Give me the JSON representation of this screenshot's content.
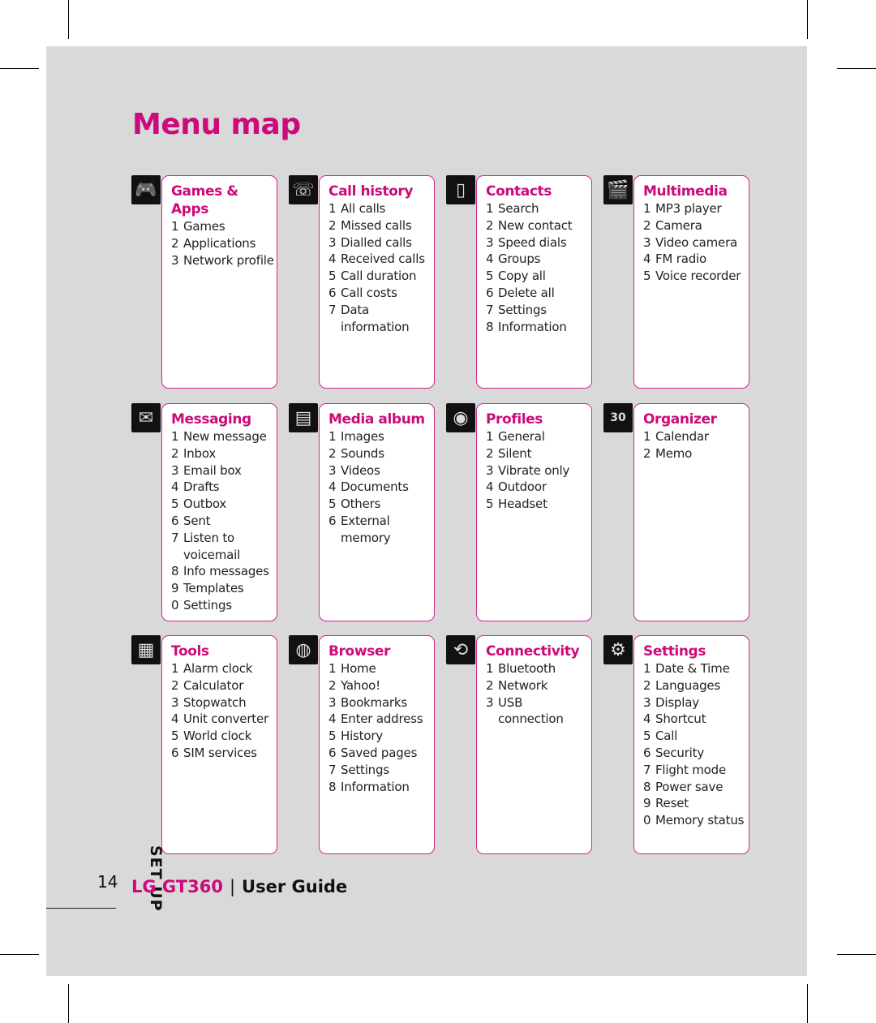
{
  "page_title": "Menu map",
  "side_label": "SET UP",
  "page_number": "14",
  "footer": {
    "brand": "LG GT360",
    "separator": "|",
    "guide": "User Guide"
  },
  "accent_color": "#cc0a7a",
  "menus": [
    {
      "icon": "gamepad-icon",
      "title": "Games & Apps",
      "items": [
        [
          "1",
          "Games"
        ],
        [
          "2",
          "Applications"
        ],
        [
          "3",
          "Network profile"
        ]
      ]
    },
    {
      "icon": "call-history-icon",
      "title": "Call history",
      "items": [
        [
          "1",
          "All calls"
        ],
        [
          "2",
          "Missed calls"
        ],
        [
          "3",
          "Dialled calls"
        ],
        [
          "4",
          "Received calls"
        ],
        [
          "5",
          "Call duration"
        ],
        [
          "6",
          "Call costs"
        ],
        [
          "7",
          "Data information"
        ]
      ]
    },
    {
      "icon": "contacts-icon",
      "title": "Contacts",
      "items": [
        [
          "1",
          "Search"
        ],
        [
          "2",
          "New contact"
        ],
        [
          "3",
          "Speed dials"
        ],
        [
          "4",
          "Groups"
        ],
        [
          "5",
          "Copy all"
        ],
        [
          "6",
          "Delete all"
        ],
        [
          "7",
          "Settings"
        ],
        [
          "8",
          "Information"
        ]
      ]
    },
    {
      "icon": "clapperboard-icon",
      "title": "Multimedia",
      "items": [
        [
          "1",
          "MP3 player"
        ],
        [
          "2",
          "Camera"
        ],
        [
          "3",
          "Video camera"
        ],
        [
          "4",
          "FM radio"
        ],
        [
          "5",
          "Voice recorder"
        ]
      ]
    },
    {
      "icon": "envelope-icon",
      "title": "Messaging",
      "items": [
        [
          "1",
          "New message"
        ],
        [
          "2",
          "Inbox"
        ],
        [
          "3",
          "Email box"
        ],
        [
          "4",
          "Drafts"
        ],
        [
          "5",
          "Outbox"
        ],
        [
          "6",
          "Sent"
        ],
        [
          "7",
          "Listen to voicemail"
        ],
        [
          "8",
          "Info messages"
        ],
        [
          "9",
          "Templates"
        ],
        [
          "0",
          "Settings"
        ]
      ]
    },
    {
      "icon": "folder-icon",
      "title": "Media album",
      "items": [
        [
          "1",
          "Images"
        ],
        [
          "2",
          "Sounds"
        ],
        [
          "3",
          "Videos"
        ],
        [
          "4",
          "Documents"
        ],
        [
          "5",
          "Others"
        ],
        [
          "6",
          "External memory"
        ]
      ]
    },
    {
      "icon": "speaker-icon",
      "title": "Profiles",
      "items": [
        [
          "1",
          "General"
        ],
        [
          "2",
          "Silent"
        ],
        [
          "3",
          "Vibrate only"
        ],
        [
          "4",
          "Outdoor"
        ],
        [
          "5",
          "Headset"
        ]
      ]
    },
    {
      "icon": "calendar-icon",
      "title": "Organizer",
      "items": [
        [
          "1",
          "Calendar"
        ],
        [
          "2",
          "Memo"
        ]
      ]
    },
    {
      "icon": "calculator-icon",
      "title": "Tools",
      "items": [
        [
          "1",
          "Alarm clock"
        ],
        [
          "2",
          "Calculator"
        ],
        [
          "3",
          "Stopwatch"
        ],
        [
          "4",
          "Unit converter"
        ],
        [
          "5",
          "World clock"
        ],
        [
          "6",
          "SIM services"
        ]
      ]
    },
    {
      "icon": "globe-icon",
      "title": "Browser",
      "items": [
        [
          "1",
          "Home"
        ],
        [
          "2",
          "Yahoo!"
        ],
        [
          "3",
          "Bookmarks"
        ],
        [
          "4",
          "Enter address"
        ],
        [
          "5",
          "History"
        ],
        [
          "6",
          "Saved pages"
        ],
        [
          "7",
          "Settings"
        ],
        [
          "8",
          "Information"
        ]
      ]
    },
    {
      "icon": "connectivity-icon",
      "title": "Connectivity",
      "items": [
        [
          "1",
          "Bluetooth"
        ],
        [
          "2",
          "Network"
        ],
        [
          "3",
          "USB connection"
        ]
      ]
    },
    {
      "icon": "gear-icon",
      "title": "Settings",
      "items": [
        [
          "1",
          "Date & Time"
        ],
        [
          "2",
          "Languages"
        ],
        [
          "3",
          "Display"
        ],
        [
          "4",
          "Shortcut"
        ],
        [
          "5",
          "Call"
        ],
        [
          "6",
          "Security"
        ],
        [
          "7",
          "Flight mode"
        ],
        [
          "8",
          "Power save"
        ],
        [
          "9",
          "Reset"
        ],
        [
          "0",
          "Memory status"
        ]
      ]
    }
  ]
}
